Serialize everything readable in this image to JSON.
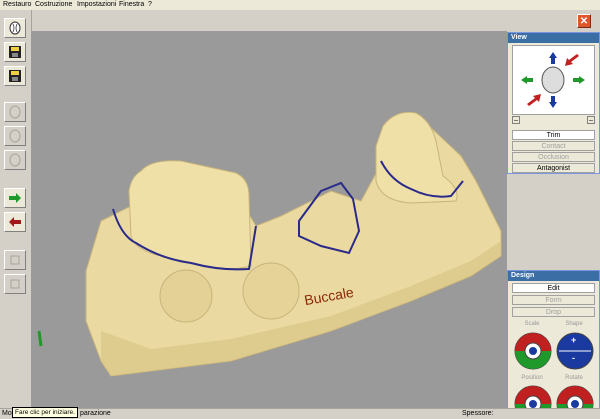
{
  "menu": {
    "items": [
      {
        "label": "Restauro"
      },
      {
        "label": "Costruzione"
      },
      {
        "label": "Impostazioni"
      },
      {
        "label": "Finestra"
      },
      {
        "label": "?"
      }
    ]
  },
  "viewport": {
    "label_buccale": "Buccale"
  },
  "view_panel": {
    "title": "View",
    "buttons": {
      "trim": "Trim",
      "contact": "Contact",
      "occlusion": "Occlusion",
      "antagonist": "Antagonist"
    },
    "small_minus_left": "–",
    "small_minus_right": "–"
  },
  "design_panel": {
    "title": "Design",
    "buttons": {
      "edit": "Edit",
      "form": "Form",
      "drop": "Drop"
    },
    "labels": {
      "scale": "Scale",
      "shape": "Shape",
      "position": "Position",
      "rotate": "Rotate"
    },
    "shape_plus": "+",
    "shape_minus": "-"
  },
  "statusbar": {
    "left_text": "Modi",
    "mid_text": "parazione",
    "spessore_label": "Spessore:"
  },
  "tooltip": {
    "text": "Fare clic per iniziare."
  },
  "colors": {
    "model_fill": "#ead9a0",
    "margin_line": "#2a2a8a",
    "label_color": "#8b2a0a",
    "title_bar": "#3a6ea5"
  },
  "icons": {
    "close": "close-icon",
    "tooth": "tooth-icon",
    "save": "save-icon",
    "arrow_next": "arrow-right-icon",
    "arrow_back": "arrow-left-icon"
  }
}
